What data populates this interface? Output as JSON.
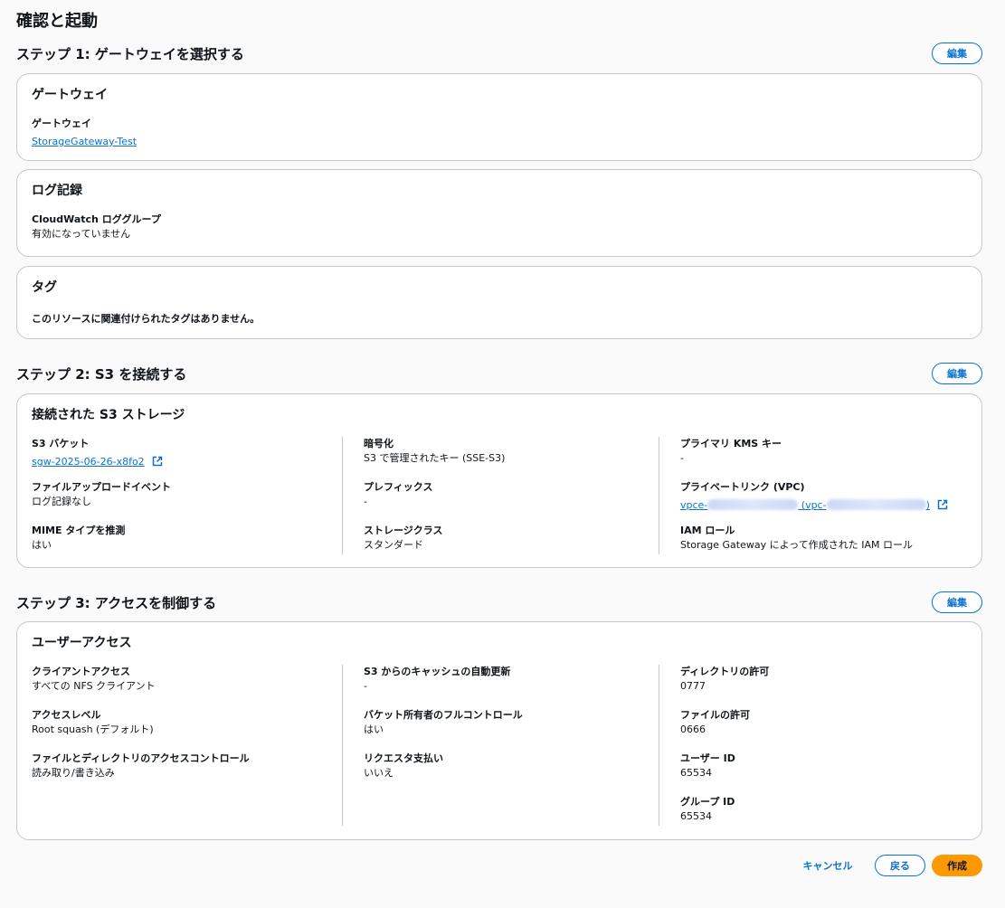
{
  "page_title": "確認と起動",
  "edit_label": "編集",
  "step1": {
    "title": "ステップ 1: ゲートウェイを選択する",
    "gateway_card": {
      "title": "ゲートウェイ",
      "label": "ゲートウェイ",
      "value": "StorageGateway-Test"
    },
    "logging_card": {
      "title": "ログ記録",
      "label": "CloudWatch ロググループ",
      "value": "有効になっていません"
    },
    "tags_card": {
      "title": "タグ",
      "text": "このリソースに関連付けられたタグはありません。"
    }
  },
  "step2": {
    "title": "ステップ 2: S3 を接続する",
    "card_title": "接続された S3 ストレージ",
    "s3_bucket": {
      "label": "S3 バケット",
      "value": "sgw-2025-06-26-x8fo2"
    },
    "file_upload_event": {
      "label": "ファイルアップロードイベント",
      "value": "ログ記録なし"
    },
    "mime_type": {
      "label": "MIME タイプを推測",
      "value": "はい"
    },
    "encryption": {
      "label": "暗号化",
      "value": "S3 で管理されたキー (SSE-S3)"
    },
    "prefix": {
      "label": "プレフィックス",
      "value": "-"
    },
    "storage_class": {
      "label": "ストレージクラス",
      "value": "スタンダード"
    },
    "primary_kms_key": {
      "label": "プライマリ KMS キー",
      "value": "-"
    },
    "private_link": {
      "label": "プライベートリンク (VPC)",
      "value_prefix": "vpce-",
      "value_middle": " (vpc-",
      "value_suffix": ")"
    },
    "iam_role": {
      "label": "IAM ロール",
      "value": "Storage Gateway によって作成された IAM ロール"
    }
  },
  "step3": {
    "title": "ステップ 3: アクセスを制御する",
    "card_title": "ユーザーアクセス",
    "client_access": {
      "label": "クライアントアクセス",
      "value": "すべての NFS クライアント"
    },
    "access_level": {
      "label": "アクセスレベル",
      "value": "Root squash (デフォルト)"
    },
    "file_dir_access": {
      "label": "ファイルとディレクトリのアクセスコントロール",
      "value": "読み取り/書き込み"
    },
    "cache_refresh": {
      "label": "S3 からのキャッシュの自動更新",
      "value": "-"
    },
    "bucket_owner": {
      "label": "バケット所有者のフルコントロール",
      "value": "はい"
    },
    "requester_pays": {
      "label": "リクエスタ支払い",
      "value": "いいえ"
    },
    "dir_permission": {
      "label": "ディレクトリの許可",
      "value": "0777"
    },
    "file_permission": {
      "label": "ファイルの許可",
      "value": "0666"
    },
    "user_id": {
      "label": "ユーザー ID",
      "value": "65534"
    },
    "group_id": {
      "label": "グループ ID",
      "value": "65534"
    }
  },
  "footer": {
    "cancel": "キャンセル",
    "back": "戻る",
    "create": "作成"
  },
  "colors": {
    "link": "#0972d3",
    "primary_button": "#ff9900",
    "border": "#c6c6cd"
  }
}
